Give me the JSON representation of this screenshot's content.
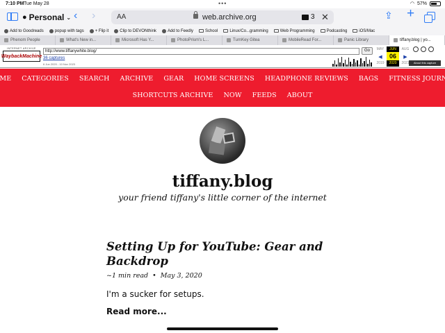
{
  "status": {
    "time": "7:10 PM",
    "date": "Tue May 28",
    "battery": "57%"
  },
  "toolbar": {
    "profile": "Personal",
    "text_size": "AA",
    "url": "web.archive.org",
    "extension_count": "3"
  },
  "bookmarks": [
    {
      "label": "Add to Goodreads",
      "icon": "bookmark-icon"
    },
    {
      "label": "popup with tags",
      "icon": "bookmark-icon"
    },
    {
      "label": "+ Flip it",
      "icon": "bookmark-icon"
    },
    {
      "label": "Clip to DEVONthink",
      "icon": "bookmark-icon"
    },
    {
      "label": "Add to Feedly",
      "icon": "bookmark-icon"
    },
    {
      "label": "School",
      "icon": "folder-icon"
    },
    {
      "label": "Linux/Co...gramming",
      "icon": "folder-icon"
    },
    {
      "label": "Web Programming",
      "icon": "folder-icon"
    },
    {
      "label": "Podcasting",
      "icon": "folder-icon"
    },
    {
      "label": "iOS/Mac",
      "icon": "folder-icon"
    }
  ],
  "tabs": [
    {
      "label": "Phenom People",
      "active": false
    },
    {
      "label": "What's New in...",
      "active": false
    },
    {
      "label": "Microsoft Has Y...",
      "active": false
    },
    {
      "label": "PhotoPrism's L...",
      "active": false
    },
    {
      "label": "TurnKey Gitea",
      "active": false
    },
    {
      "label": "MobileRead For...",
      "active": false
    },
    {
      "label": "Panic Library",
      "active": false
    },
    {
      "label": "tiffany.blog | yo...",
      "active": true
    }
  ],
  "wayback": {
    "logo_top": "INTERNET ARCHIVE",
    "logo_main": "WaybackMachine",
    "url_value": "http://www.tiffanywhite.blog/",
    "go_label": "Go",
    "captures": "36 captures",
    "range": "6 Jun 2020 - 10 Nov 2023",
    "calendar": [
      {
        "month": "MAY",
        "day": "",
        "year": "2019"
      },
      {
        "month": "JUN",
        "day": "06",
        "year": "2020"
      },
      {
        "month": "AUG",
        "day": "",
        "year": "2021"
      }
    ],
    "about": "About this capture"
  },
  "nav": {
    "row1": [
      "HOME",
      "CATEGORIES",
      "SEARCH",
      "ARCHIVE",
      "GEAR",
      "HOME SCREENS",
      "HEADPHONE REVIEWS",
      "BAGS",
      "FITNESS JOURNEY"
    ],
    "row2": [
      "SHORTCUTS ARCHIVE",
      "NOW",
      "FEEDS",
      "ABOUT"
    ]
  },
  "site": {
    "title": "tiffany.blog",
    "tagline": "your friend tiffany's little corner of the internet"
  },
  "post": {
    "title": "Setting Up for YouTube: Gear and Backdrop",
    "read_time": "~1 min read",
    "separator": "•",
    "date": "May 3, 2020",
    "excerpt": "I'm a sucker for setups.",
    "read_more": "Read more..."
  },
  "colors": {
    "nav_bg": "#ee1c2e",
    "safari_blue": "#2f7cf6"
  }
}
